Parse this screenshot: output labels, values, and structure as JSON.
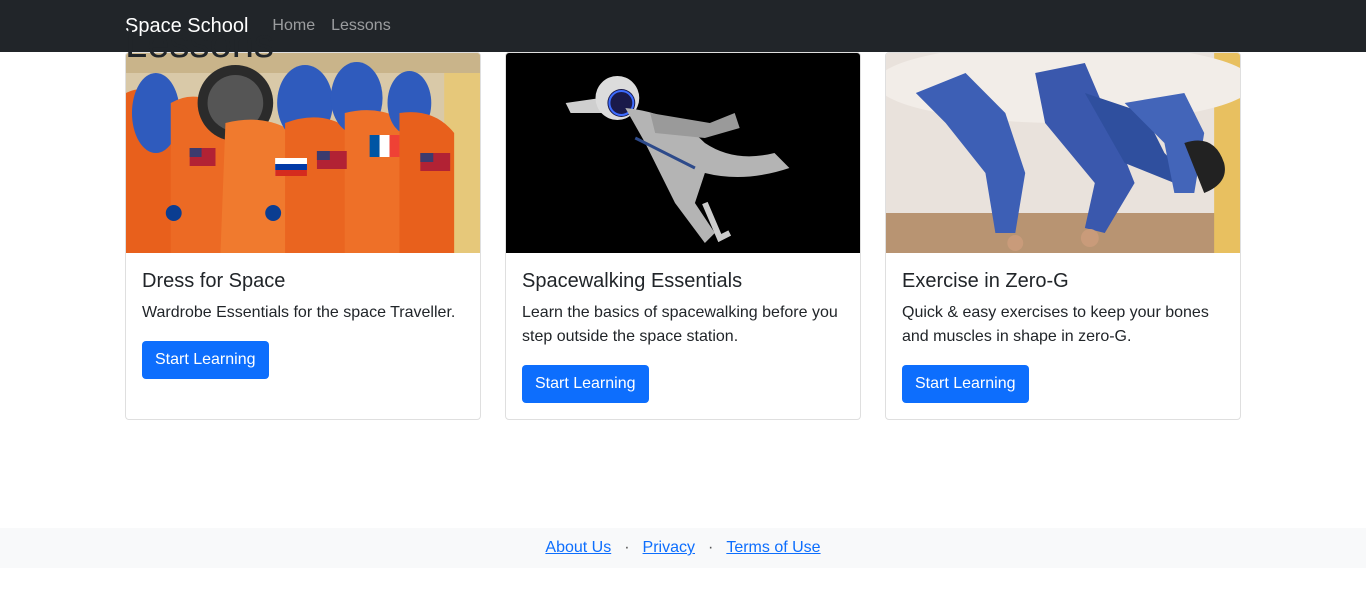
{
  "navbar": {
    "brand": "Space School",
    "links": [
      "Home",
      "Lessons"
    ]
  },
  "page": {
    "title": "Lessons"
  },
  "cards": [
    {
      "title": "Dress for Space",
      "text": "Wardrobe Essentials for the space Traveller.",
      "button": "Start Learning",
      "image": "orange spacesuits hanging"
    },
    {
      "title": "Spacewalking Essentials",
      "text": "Learn the basics of spacewalking before you step outside the space station.",
      "button": "Start Learning",
      "image": "astronaut floating in dark space"
    },
    {
      "title": "Exercise in Zero-G",
      "text": "Quick & easy exercises to keep your bones and muscles in shape in zero-G.",
      "button": "Start Learning",
      "image": "people floating in blue flight suits"
    }
  ],
  "footer": {
    "links": [
      "About Us",
      "Privacy",
      "Terms of Use"
    ],
    "separator": "·"
  },
  "colors": {
    "navbar_bg": "#212529",
    "primary": "#0d6efd",
    "footer_bg": "#f8f9fa"
  }
}
